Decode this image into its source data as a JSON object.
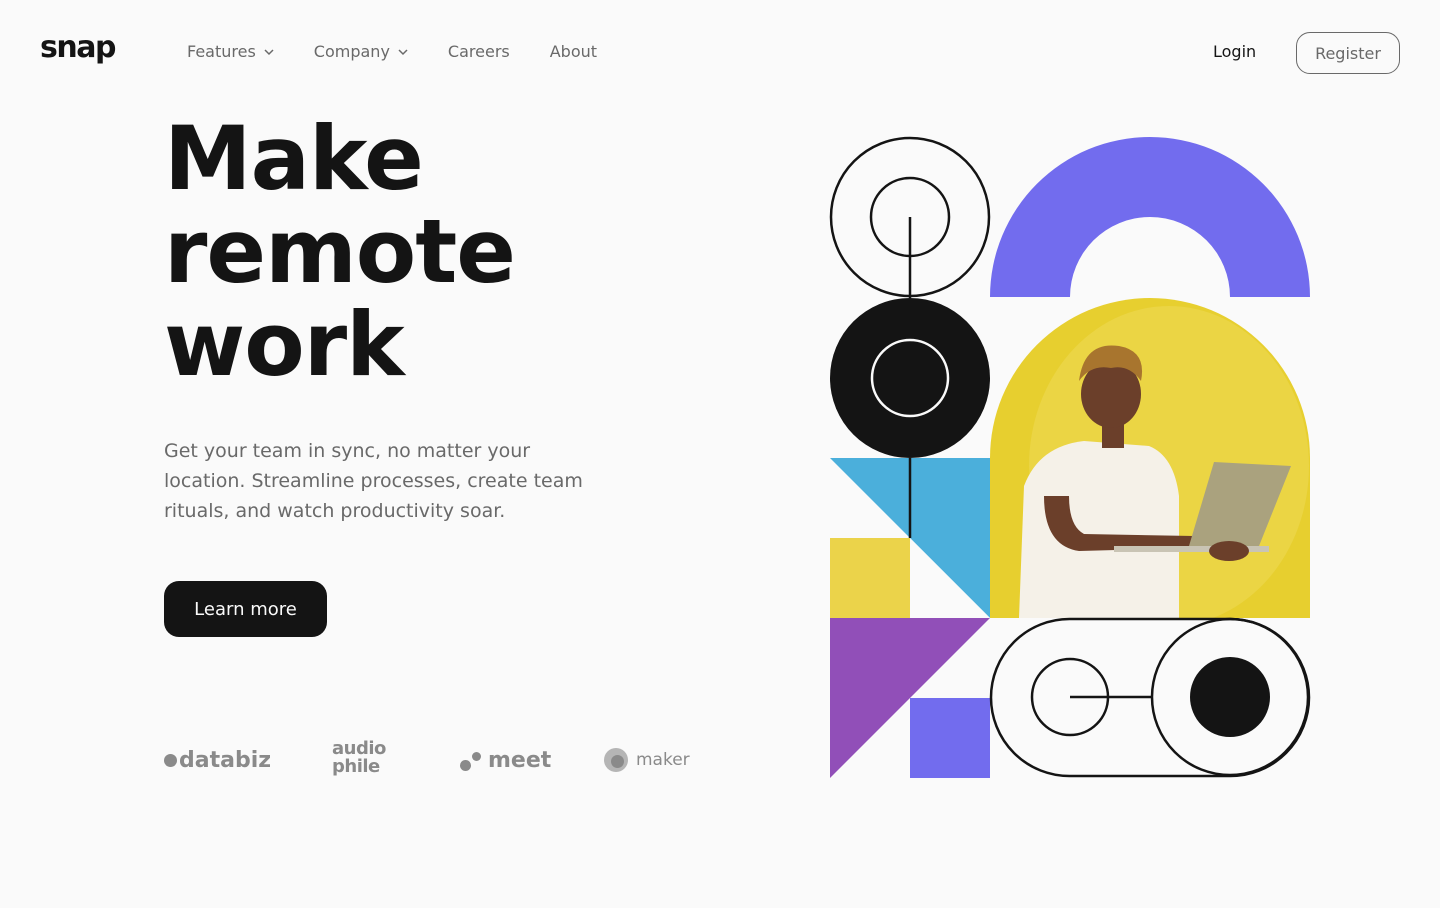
{
  "header": {
    "logo": "snap",
    "nav": [
      {
        "label": "Features",
        "has_dropdown": true
      },
      {
        "label": "Company",
        "has_dropdown": true
      },
      {
        "label": "Careers",
        "has_dropdown": false
      },
      {
        "label": "About",
        "has_dropdown": false
      }
    ],
    "login_label": "Login",
    "register_label": "Register"
  },
  "hero": {
    "title_lines": [
      "Make",
      "remote",
      "work"
    ],
    "description": "Get your team in sync, no matter your location. Streamline processes, create team rituals, and watch productivity soar.",
    "cta_label": "Learn more"
  },
  "clients": {
    "databiz": "databiz",
    "audiophile_top": "audio",
    "audiophile_bottom": "phile",
    "meet": "meet",
    "maker": "maker"
  },
  "colors": {
    "background": "#fafafa",
    "text_dark": "#141414",
    "text_medium": "#696969",
    "purple": "#726cee",
    "yellow": "#ebd34a",
    "blue": "#4bafdb",
    "violet": "#914fb8"
  },
  "icons": {
    "dropdown": "chevron-down-icon"
  }
}
